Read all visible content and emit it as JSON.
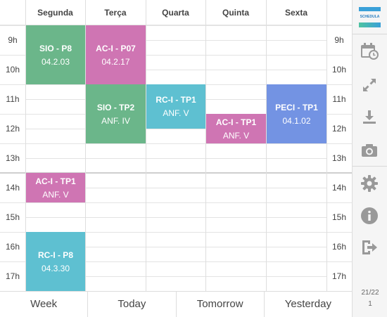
{
  "days": [
    "Segunda",
    "Terça",
    "Quarta",
    "Quinta",
    "Sexta"
  ],
  "hours": [
    "9h",
    "10h",
    "11h",
    "12h",
    "13h",
    "14h",
    "15h",
    "16h",
    "17h"
  ],
  "events": [
    {
      "title": "SIO - P8",
      "room": "04.2.03",
      "day": 0,
      "start": 9,
      "end": 11,
      "color": "#6bb68a"
    },
    {
      "title": "AC-I - P07",
      "room": "04.2.17",
      "day": 1,
      "start": 9,
      "end": 11,
      "color": "#cf75b3"
    },
    {
      "title": "SIO - TP2",
      "room": "ANF. IV",
      "day": 1,
      "start": 11,
      "end": 13,
      "color": "#6bb68a"
    },
    {
      "title": "RC-I - TP1",
      "room": "ANF. V",
      "day": 2,
      "start": 11,
      "end": 12.5,
      "color": "#5ec0d1"
    },
    {
      "title": "AC-I - TP1",
      "room": "ANF. V",
      "day": 3,
      "start": 12,
      "end": 13,
      "color": "#cf75b3"
    },
    {
      "title": "PECI - TP1",
      "room": "04.1.02",
      "day": 4,
      "start": 11,
      "end": 13,
      "color": "#7393e3"
    },
    {
      "title": "AC-I - TP1",
      "room": "ANF. V",
      "day": 0,
      "start": 14,
      "end": 15,
      "color": "#cf75b3"
    },
    {
      "title": "RC-I - P8",
      "room": "04.3.30",
      "day": 0,
      "start": 16,
      "end": 18,
      "color": "#5ec0d1"
    }
  ],
  "bottom_nav": [
    "Week",
    "Today",
    "Tomorrow",
    "Yesterday"
  ],
  "sidebar": {
    "logo_text": "SCHEDULA",
    "pager_top": "21/22",
    "pager_bottom": "1",
    "icon_color": "#999999"
  }
}
